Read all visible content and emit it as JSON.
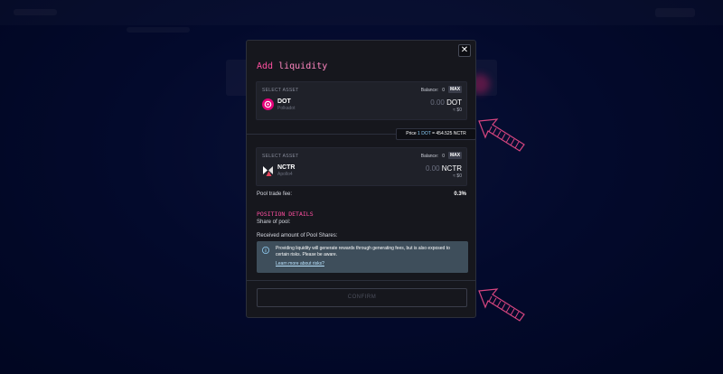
{
  "modal": {
    "close_symbol": "✕",
    "title_prefix": "Add ",
    "title_rest": "liquidity"
  },
  "asset_a": {
    "select_label": "SELECT ASSET",
    "balance_label": "Balance:",
    "balance_value": "0",
    "max_label": "MAX",
    "symbol": "DOT",
    "name": "Polkadot",
    "amount_zero": "0.00",
    "amount_symbol": "DOT",
    "usd": "≈ $0",
    "icon": "polkadot-icon",
    "icon_color": "#e6007a"
  },
  "price": {
    "label": "Price",
    "base": "1 DOT",
    "eq": "=",
    "quote": "454.525 NCTR"
  },
  "asset_b": {
    "select_label": "SELECT ASSET",
    "balance_label": "Balance:",
    "balance_value": "0",
    "max_label": "MAX",
    "symbol": "NCTR",
    "name": "Apollo4",
    "amount_zero": "0.00",
    "amount_symbol": "NCTR",
    "usd": "≈ $0",
    "icon": "nectar-icon",
    "warning_icon": "warning-icon"
  },
  "fee": {
    "label": "Pool trade fee:",
    "value": "0.3%"
  },
  "position": {
    "title": "POSITION DETAILS",
    "share_label": "Share of pool:",
    "received_label": "Received amount of Pool Shares:"
  },
  "info": {
    "text": "Providing liquidity will generate rewards through generating fees, but is also exposed to certain risks. Please be aware.",
    "link": "Learn more about risks?",
    "icon": "info-icon"
  },
  "confirm_label": "CONFIRM",
  "colors": {
    "accent_pink": "#ff4fa0",
    "background": "#02092c",
    "modal": "#16171d",
    "info_box": "#3e4e5b"
  }
}
